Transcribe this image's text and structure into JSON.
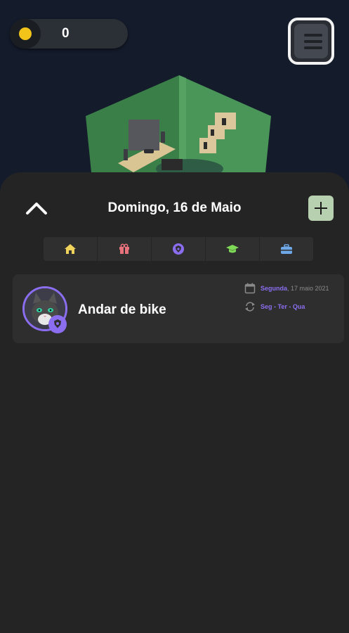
{
  "header": {
    "coin_count": "0",
    "coin_color": "#f2c318"
  },
  "room": {
    "wall_color": "#3f8a4f",
    "floor_color": "#d8c392"
  },
  "panel": {
    "date_title": "Domingo, 16 de Maio",
    "collapse_icon": "chevron-up-icon",
    "add_icon": "plus-icon",
    "categories": [
      {
        "icon": "home-icon",
        "color": "#f0d35a"
      },
      {
        "icon": "gift-icon",
        "color": "#e8727c"
      },
      {
        "icon": "shield-icon",
        "color": "#8b6ef0"
      },
      {
        "icon": "graduation-cap-icon",
        "color": "#7ed957"
      },
      {
        "icon": "briefcase-icon",
        "color": "#6fa8e8"
      }
    ]
  },
  "task": {
    "title": "Andar de bike",
    "date_day": "Segunda",
    "date_rest": ", 17 maio 2021",
    "repeat": "Seg - Ter - Qua",
    "accent": "#8b6ef0"
  }
}
